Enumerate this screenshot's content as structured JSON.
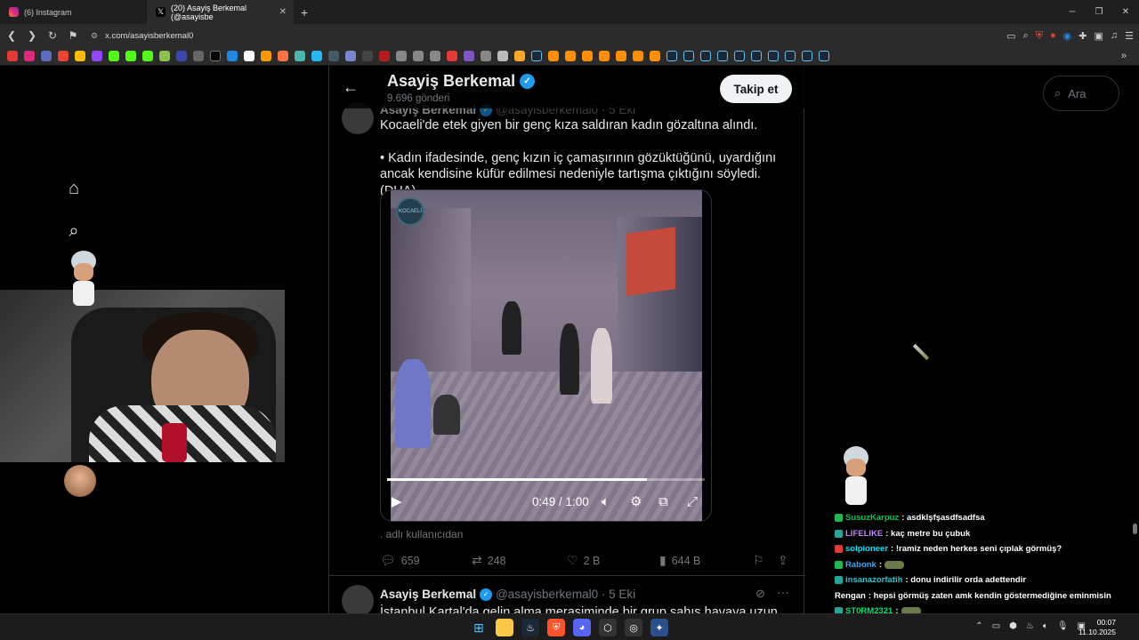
{
  "browser": {
    "tabs": [
      {
        "title": "(6) Instagram",
        "active": false,
        "icon": "instagram-icon",
        "color": "#e1306c"
      },
      {
        "title": "(20) Asayiş Berkemal (@asayisbe",
        "active": true,
        "icon": "x-logo-icon",
        "color": "#000000"
      }
    ],
    "new_tab": "+",
    "url": "x.com/asayisberkemal0"
  },
  "profile": {
    "name": "Asayiş Berkemal",
    "post_count": "9.696 gönderi",
    "follow_label": "Takip et"
  },
  "search": {
    "placeholder": "Ara"
  },
  "tweet1": {
    "name": "Asayiş Berkemal",
    "handle": "@asayisberkemal0 · 5 Eki",
    "text_line1": "Kocaeli'de etek giyen bir genç kıza saldıran kadın gözaltına alındı.",
    "text_line2": "• Kadın ifadesinde, genç kızın iç çamaşırının gözüktüğünü, uyardığını ancak kendisine küfür edilmesi nedeniyle tartışma çıktığını söyledi. (DHA)",
    "video": {
      "logo": "KOCAELİ",
      "time": "0:49 / 1:00",
      "progress": 0.817
    },
    "alt_note": ". adlı kullanıcıdan",
    "replies": "659",
    "reposts": "248",
    "likes": "2 B",
    "views": "644 B"
  },
  "tweet2": {
    "name": "Asayiş Berkemal",
    "handle": "@asayisberkemal0 · 5 Eki",
    "text": "İstanbul Kartal'da gelin alma merasiminde bir grup şahıs havaya uzun"
  },
  "chat": [
    {
      "user": "SusuzKarpuz",
      "msg": ": asdklşfşasdfsadfsa",
      "color": "#00c853",
      "badge": "#1db954"
    },
    {
      "user": "LIFELIKE",
      "msg": ": kaç metre bu çubuk",
      "color": "#c77dff",
      "badge": "#26a69a"
    },
    {
      "user": "solpioneer",
      "msg": ": !ramiz neden herkes seni çıplak görmüş?",
      "color": "#00e5ff",
      "badge": "#e53935"
    },
    {
      "user": "Rabonk",
      "msg": ":",
      "color": "#42a5f5",
      "badge": "#1db954",
      "emote": true
    },
    {
      "user": "insanazorfatih",
      "msg": ": donu indirilir orda adettendir",
      "color": "#26c6da",
      "badge": "#26a69a"
    },
    {
      "user": "Rengan",
      "msg": ": hepsi görmüş zaten amk kendin göstermediğine eminmisin",
      "color": "#ffffff",
      "badge": ""
    },
    {
      "user": "ST0RM2321",
      "msg": ":",
      "color": "#00e676",
      "badge": "#26a69a",
      "emote": true
    }
  ],
  "clock": {
    "time": "00:07",
    "date": "11.10.2025"
  }
}
